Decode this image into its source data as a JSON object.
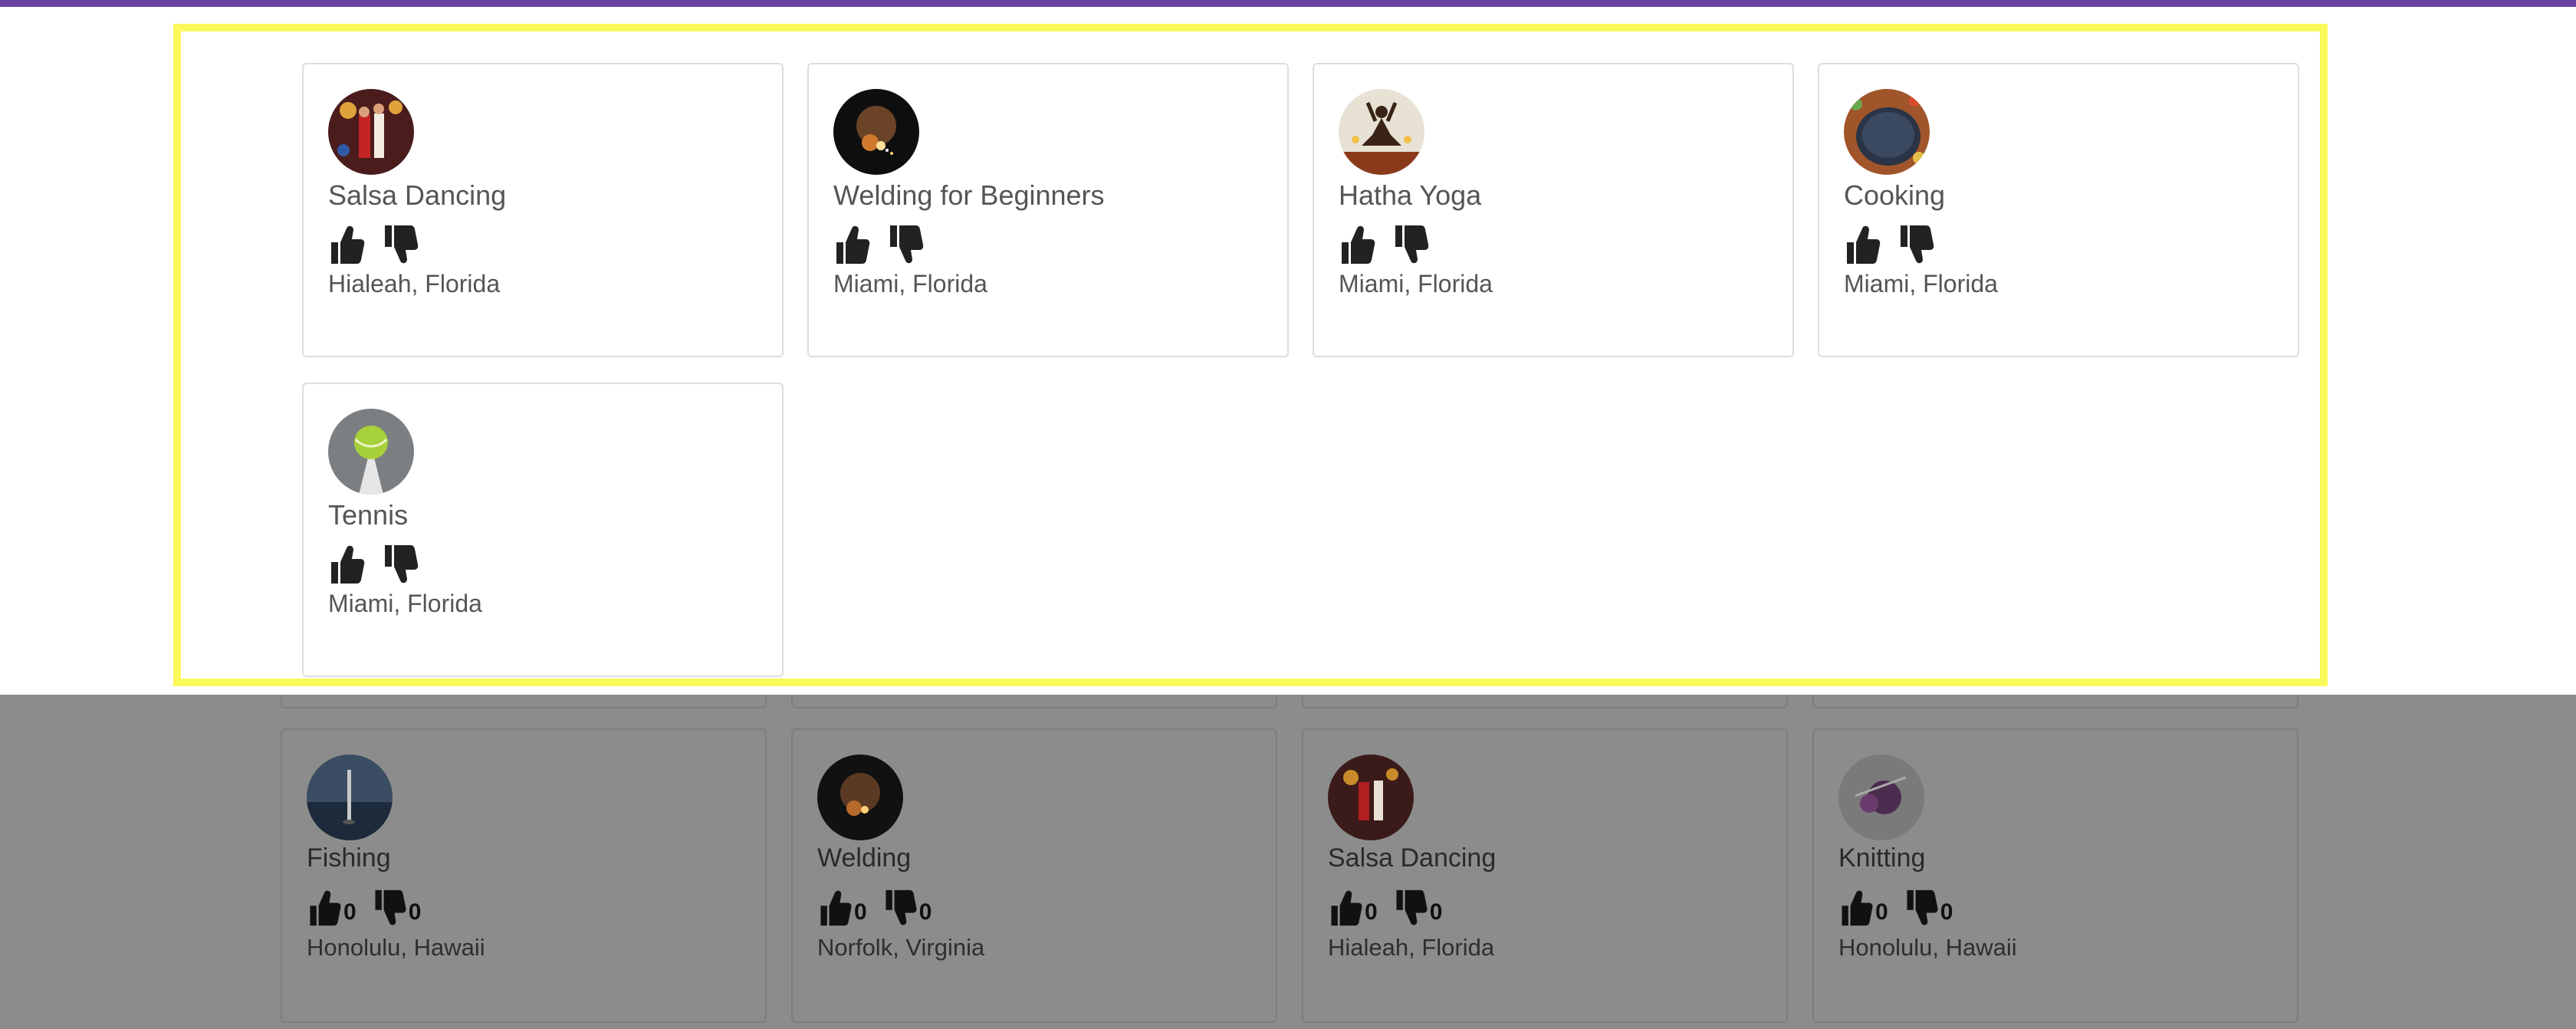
{
  "colors": {
    "top_bar": "#6a44a0",
    "highlight_border": "#fbf85a",
    "backdrop": "#8c8c8c"
  },
  "highlighted_cards": [
    {
      "title": "Salsa Dancing",
      "location": "Hialeah, Florida",
      "avatar": "salsa-dancing-photo"
    },
    {
      "title": "Welding for Beginners",
      "location": "Miami, Florida",
      "avatar": "welding-photo"
    },
    {
      "title": "Hatha Yoga",
      "location": "Miami, Florida",
      "avatar": "yoga-photo"
    },
    {
      "title": "Cooking",
      "location": "Miami, Florida",
      "avatar": "cooking-pan-photo"
    },
    {
      "title": "Tennis",
      "location": "Miami, Florida",
      "avatar": "tennis-ball-photo"
    }
  ],
  "background_cards": [
    {
      "title": "Fishing",
      "likes": "0",
      "dislikes": "0",
      "location": "Honolulu, Hawaii",
      "avatar": "fishing-photo"
    },
    {
      "title": "Welding",
      "likes": "0",
      "dislikes": "0",
      "location": "Norfolk, Virginia",
      "avatar": "welding-photo"
    },
    {
      "title": "Salsa Dancing",
      "likes": "0",
      "dislikes": "0",
      "location": "Hialeah, Florida",
      "avatar": "salsa-dancing-photo"
    },
    {
      "title": "Knitting",
      "likes": "0",
      "dislikes": "0",
      "location": "Honolulu, Hawaii",
      "avatar": "knitting-photo"
    }
  ]
}
